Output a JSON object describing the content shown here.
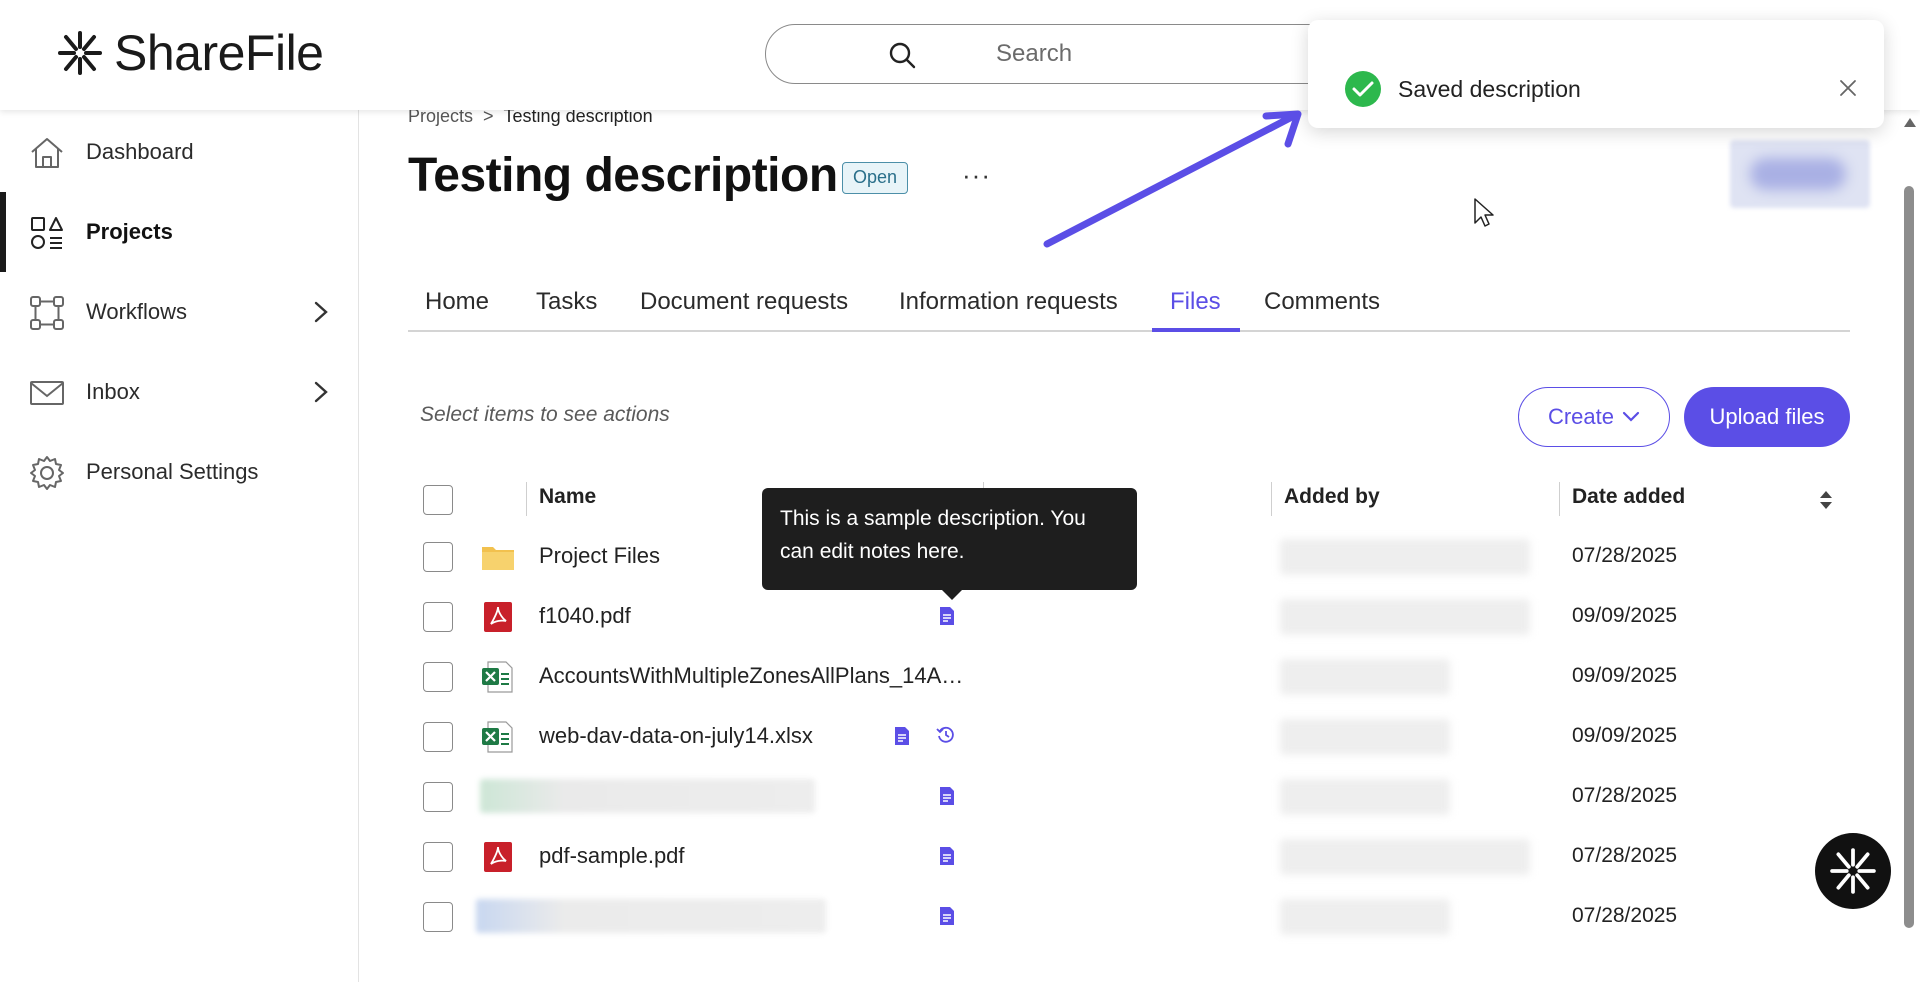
{
  "app": {
    "name": "ShareFile"
  },
  "search": {
    "placeholder": "Search"
  },
  "sidebar": {
    "items": [
      {
        "label": "Dashboard",
        "icon": "home-icon"
      },
      {
        "label": "Projects",
        "icon": "projects-icon",
        "active": true
      },
      {
        "label": "Workflows",
        "icon": "workflows-icon",
        "has_submenu": true
      },
      {
        "label": "Inbox",
        "icon": "mail-icon",
        "has_submenu": true
      },
      {
        "label": "Personal Settings",
        "icon": "gear-icon"
      }
    ]
  },
  "breadcrumb": {
    "parent": "Projects",
    "separator": ">",
    "current": "Testing description"
  },
  "page": {
    "title": "Testing description",
    "status": "Open",
    "more": "···"
  },
  "tabs": [
    {
      "label": "Home"
    },
    {
      "label": "Tasks"
    },
    {
      "label": "Document requests"
    },
    {
      "label": "Information requests"
    },
    {
      "label": "Files",
      "active": true
    },
    {
      "label": "Comments"
    }
  ],
  "toolbar": {
    "hint": "Select items to see actions",
    "create_label": "Create",
    "upload_label": "Upload files"
  },
  "table": {
    "headers": {
      "name": "Name",
      "added_by": "Added by",
      "date_added": "Date added"
    },
    "rows": [
      {
        "name": "Project Files",
        "type": "folder",
        "date": "07/28/2025"
      },
      {
        "name": "f1040.pdf",
        "type": "pdf",
        "date": "09/09/2025",
        "has_note": true
      },
      {
        "name": "AccountsWithMultipleZonesAllPlans_14A…",
        "type": "xlsx",
        "date": "09/09/2025"
      },
      {
        "name": "web-dav-data-on-july14.xlsx",
        "type": "xlsx",
        "date": "09/09/2025",
        "has_note": true,
        "has_history": true
      },
      {
        "name": "",
        "type": "blurred",
        "date": "07/28/2025",
        "has_note": true
      },
      {
        "name": "pdf-sample.pdf",
        "type": "pdf",
        "date": "07/28/2025",
        "has_note": true
      },
      {
        "name": "",
        "type": "blurred",
        "date": "07/28/2025",
        "has_note": true
      }
    ]
  },
  "tooltip": {
    "text": "This is a sample description. You can edit notes here."
  },
  "toast": {
    "message": "Saved description",
    "status": "success"
  },
  "colors": {
    "accent": "#5b4ee6",
    "success": "#2db84d",
    "pdf": "#c8202a",
    "excel": "#1e7a45",
    "folder": "#f2c14e"
  }
}
